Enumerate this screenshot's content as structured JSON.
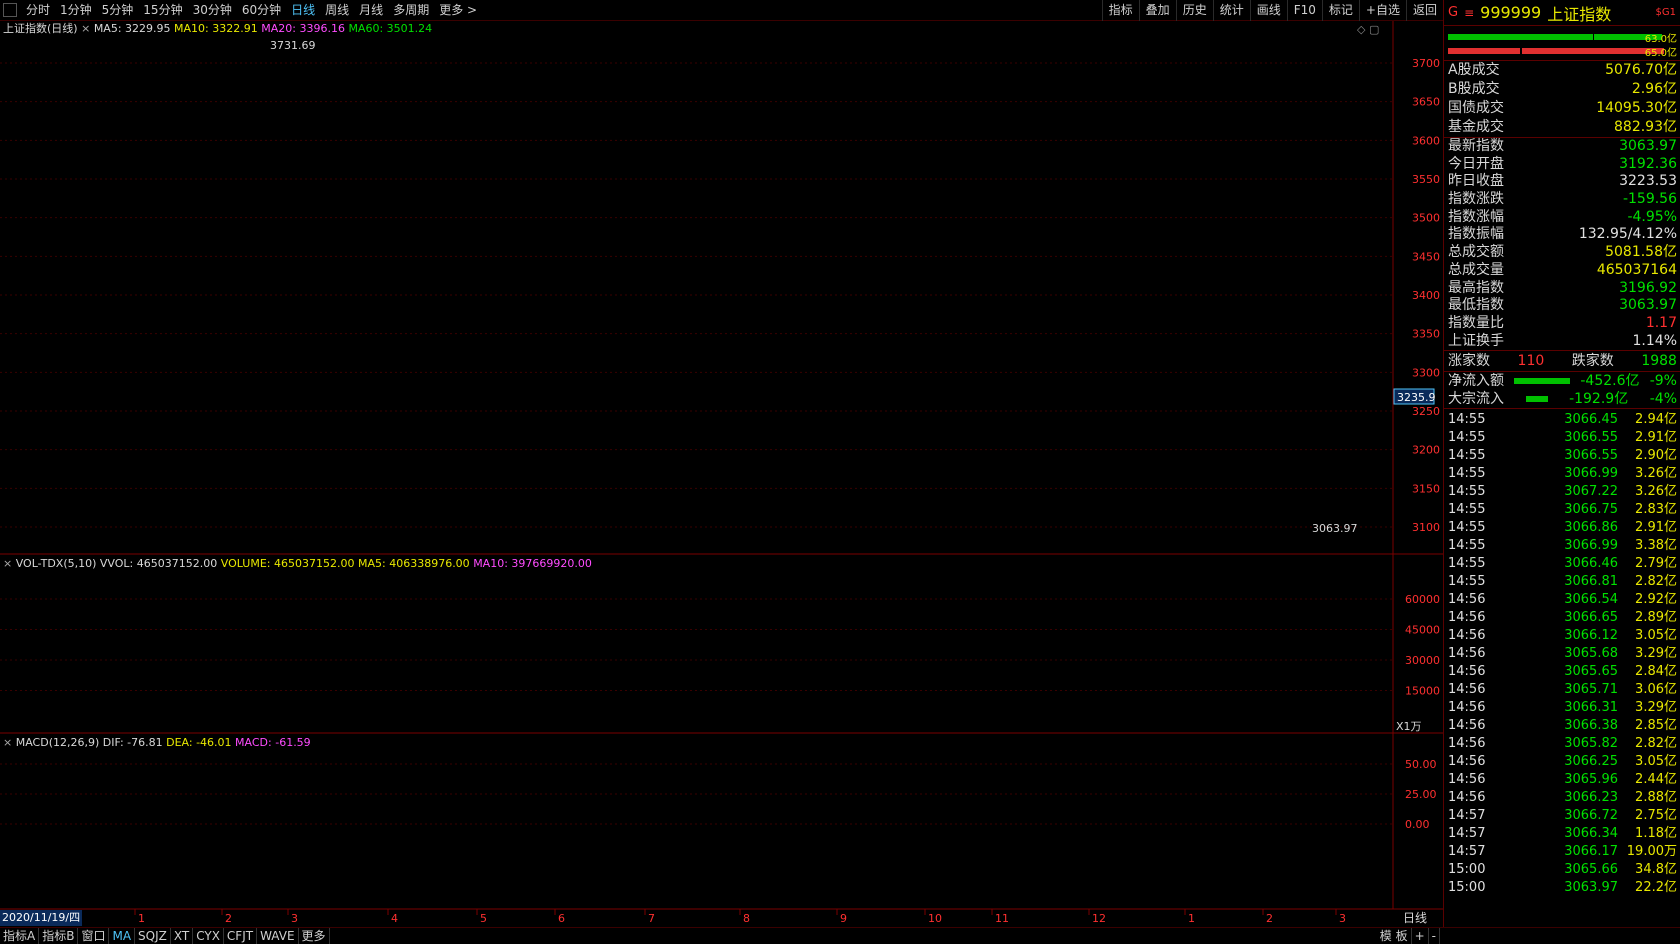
{
  "topbar": {
    "periods": [
      "分时",
      "1分钟",
      "5分钟",
      "15分钟",
      "30分钟",
      "60分钟",
      "日线",
      "周线",
      "月线",
      "多周期",
      "更多 >"
    ],
    "active_period": "日线",
    "tools": [
      "指标",
      "叠加",
      "历史",
      "统计",
      "画线",
      "F10",
      "标记",
      "+自选",
      "返回"
    ]
  },
  "main_pane": {
    "title": "上证指数(日线)",
    "ma5_label": "MA5: 3229.95",
    "ma10_label": "MA10: 3322.91",
    "ma20_label": "MA20: 3396.16",
    "ma60_label": "MA60: 3501.24",
    "high_label": "3731.69",
    "low_label": "3063.97",
    "current_price_tag": "3235.9",
    "y_ticks": [
      "3700",
      "3650",
      "3600",
      "3550",
      "3500",
      "3450",
      "3400",
      "3350",
      "3300",
      "3250",
      "3200",
      "3150",
      "3100"
    ]
  },
  "volume_pane": {
    "title": "VOL-TDX(5,10)",
    "vvol": "VVOL: 465037152.00",
    "volume": "VOLUME: 465037152.00",
    "ma5": "MA5: 406338976.00",
    "ma10": "MA10: 397669920.00",
    "y_ticks": [
      "60000",
      "45000",
      "30000",
      "15000"
    ],
    "unit": "X1万"
  },
  "macd_pane": {
    "title": "MACD(12,26,9)",
    "dif": "DIF: -76.81",
    "dea": "DEA: -46.01",
    "macd": "MACD: -61.59",
    "y_ticks": [
      "50.00",
      "25.00",
      "0.00"
    ]
  },
  "date_axis": {
    "start_label": "2020/11/19/四",
    "months": [
      "1",
      "2",
      "3",
      "4",
      "5",
      "6",
      "7",
      "8",
      "9",
      "10",
      "11",
      "12",
      "1",
      "2",
      "3"
    ],
    "period_label": "日线"
  },
  "bottombar": {
    "tabs": [
      "指标A",
      "指标B",
      "窗口",
      "MA",
      "SQJZ",
      "XT",
      "CYX",
      "CFJT",
      "WAVE",
      "更多"
    ],
    "active_tab": "MA",
    "right_items": [
      "模 板",
      "+",
      "-"
    ]
  },
  "side": {
    "header_code": "999999",
    "header_name": "上证指数",
    "header_badge": "$G1",
    "bar1_value": "63.0亿",
    "bar2_value": "65.0亿",
    "turnover_rows": [
      {
        "label": "A股成交",
        "value": "5076.70亿"
      },
      {
        "label": "B股成交",
        "value": "2.96亿"
      },
      {
        "label": "国债成交",
        "value": "14095.30亿"
      },
      {
        "label": "基金成交",
        "value": "882.93亿"
      }
    ],
    "index_rows": [
      {
        "label": "最新指数",
        "value": "3063.97",
        "tone": "green"
      },
      {
        "label": "今日开盘",
        "value": "3192.36",
        "tone": "green"
      },
      {
        "label": "昨日收盘",
        "value": "3223.53",
        "tone": "white"
      },
      {
        "label": "指数涨跌",
        "value": "-159.56",
        "tone": "green"
      },
      {
        "label": "指数涨幅",
        "value": "-4.95%",
        "tone": "green"
      },
      {
        "label": "指数振幅",
        "value": "132.95/4.12%",
        "tone": "white"
      },
      {
        "label": "总成交额",
        "value": "5081.58亿",
        "tone": "yellow"
      },
      {
        "label": "总成交量",
        "value": "465037164",
        "tone": "yellow"
      },
      {
        "label": "最高指数",
        "value": "3196.92",
        "tone": "green"
      },
      {
        "label": "最低指数",
        "value": "3063.97",
        "tone": "green"
      },
      {
        "label": "指数量比",
        "value": "1.17",
        "tone": "red"
      },
      {
        "label": "上证换手",
        "value": "1.14%",
        "tone": "white"
      }
    ],
    "up_label": "涨家数",
    "up_count": "110",
    "down_label": "跌家数",
    "down_count": "1988",
    "flow_rows": [
      {
        "label": "净流入额",
        "value": "-452.6亿",
        "pct": "-9%"
      },
      {
        "label": "大宗流入",
        "value": "-192.9亿",
        "pct": "-4%"
      }
    ],
    "ticks": [
      {
        "t": "14:55",
        "p": "3066.45",
        "v": "2.94亿"
      },
      {
        "t": "14:55",
        "p": "3066.55",
        "v": "2.91亿"
      },
      {
        "t": "14:55",
        "p": "3066.55",
        "v": "2.90亿"
      },
      {
        "t": "14:55",
        "p": "3066.99",
        "v": "3.26亿"
      },
      {
        "t": "14:55",
        "p": "3067.22",
        "v": "3.26亿"
      },
      {
        "t": "14:55",
        "p": "3066.75",
        "v": "2.83亿"
      },
      {
        "t": "14:55",
        "p": "3066.86",
        "v": "2.91亿"
      },
      {
        "t": "14:55",
        "p": "3066.99",
        "v": "3.38亿"
      },
      {
        "t": "14:55",
        "p": "3066.46",
        "v": "2.79亿"
      },
      {
        "t": "14:55",
        "p": "3066.81",
        "v": "2.82亿"
      },
      {
        "t": "14:56",
        "p": "3066.54",
        "v": "2.92亿"
      },
      {
        "t": "14:56",
        "p": "3066.65",
        "v": "2.89亿"
      },
      {
        "t": "14:56",
        "p": "3066.12",
        "v": "3.05亿"
      },
      {
        "t": "14:56",
        "p": "3065.68",
        "v": "3.29亿"
      },
      {
        "t": "14:56",
        "p": "3065.65",
        "v": "2.84亿"
      },
      {
        "t": "14:56",
        "p": "3065.71",
        "v": "3.06亿"
      },
      {
        "t": "14:56",
        "p": "3066.31",
        "v": "3.29亿"
      },
      {
        "t": "14:56",
        "p": "3066.38",
        "v": "2.85亿"
      },
      {
        "t": "14:56",
        "p": "3065.82",
        "v": "2.82亿"
      },
      {
        "t": "14:56",
        "p": "3066.25",
        "v": "3.05亿"
      },
      {
        "t": "14:56",
        "p": "3065.96",
        "v": "2.44亿"
      },
      {
        "t": "14:56",
        "p": "3066.23",
        "v": "2.88亿"
      },
      {
        "t": "14:57",
        "p": "3066.72",
        "v": "2.75亿"
      },
      {
        "t": "14:57",
        "p": "3066.34",
        "v": "1.18亿"
      },
      {
        "t": "14:57",
        "p": "3066.17",
        "v": "19.00万"
      },
      {
        "t": "15:00",
        "p": "3065.66",
        "v": "34.8亿"
      },
      {
        "t": "15:00",
        "p": "3063.97",
        "v": "22.2亿"
      }
    ]
  }
}
